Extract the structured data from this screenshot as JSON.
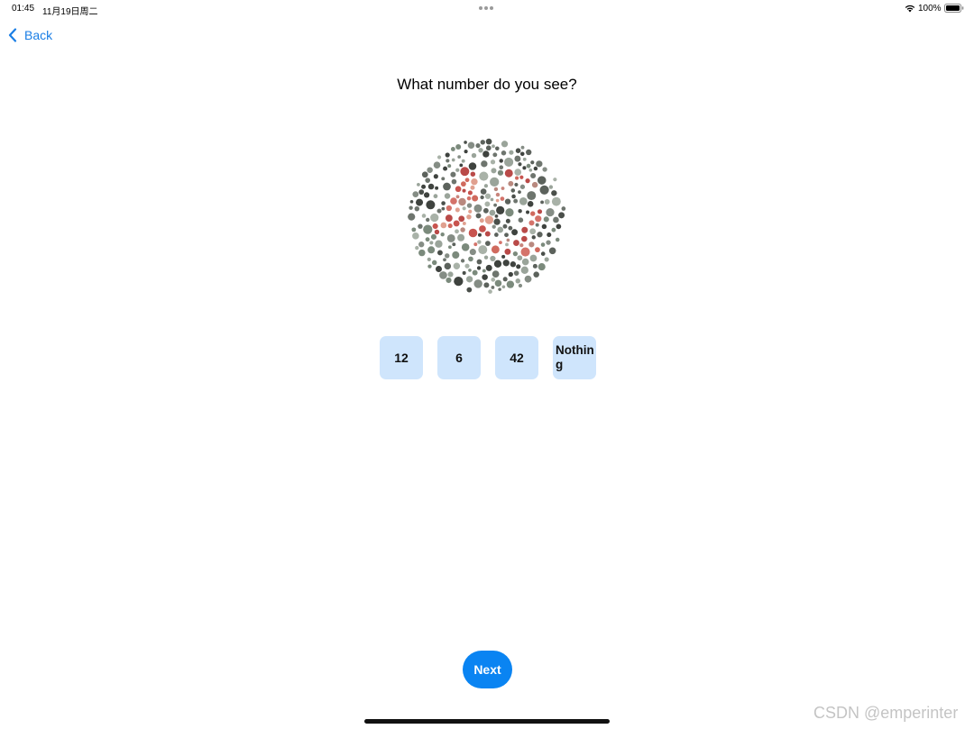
{
  "status_bar": {
    "time": "01:45",
    "date": "11月19日周二",
    "battery": "100%",
    "icons": [
      "multitask-dots-icon",
      "wifi-icon",
      "battery-icon"
    ]
  },
  "nav": {
    "back_label": "Back",
    "back_icon": "chevron-left-icon",
    "accent_color": "#1a7ee5"
  },
  "question": "What number do you see?",
  "plate": {
    "icon": "color-blindness-test-plate"
  },
  "options": [
    {
      "label": "12"
    },
    {
      "label": "6"
    },
    {
      "label": "42"
    },
    {
      "label": "Nothing"
    }
  ],
  "next_label": "Next",
  "watermark": "CSDN @emperinter",
  "colors": {
    "option_bg": "#cfe5fc",
    "next_bg": "#0a84f2"
  }
}
